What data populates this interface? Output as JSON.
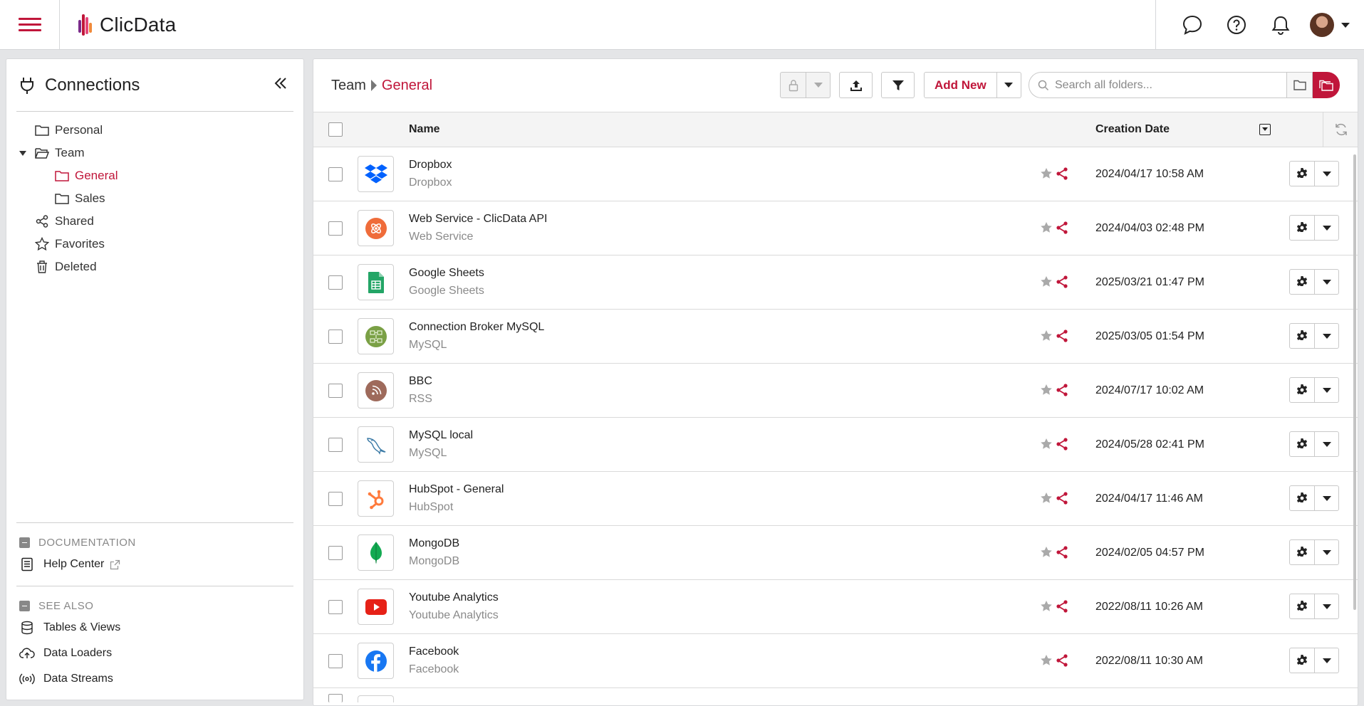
{
  "app": {
    "brand_name": "ClicData"
  },
  "colors": {
    "accent": "#c0163a"
  },
  "sidebar": {
    "title": "Connections",
    "tree": [
      {
        "label": "Personal",
        "icon": "folder-icon"
      },
      {
        "label": "Team",
        "icon": "folder-open-icon",
        "expanded": true
      },
      {
        "label": "General",
        "icon": "folder-icon",
        "selected": true
      },
      {
        "label": "Sales",
        "icon": "folder-icon"
      },
      {
        "label": "Shared",
        "icon": "share-icon"
      },
      {
        "label": "Favorites",
        "icon": "star-icon"
      },
      {
        "label": "Deleted",
        "icon": "trash-icon"
      }
    ],
    "documentation": {
      "heading": "DOCUMENTATION",
      "help_center": "Help Center"
    },
    "see_also": {
      "heading": "SEE ALSO",
      "links": [
        "Tables & Views",
        "Data Loaders",
        "Data Streams"
      ]
    }
  },
  "breadcrumb": {
    "root": "Team",
    "current": "General"
  },
  "toolbar": {
    "add_new_label": "Add New",
    "search_placeholder": "Search all folders..."
  },
  "table": {
    "headers": {
      "name": "Name",
      "creation_date": "Creation Date"
    },
    "rows": [
      {
        "name": "Dropbox",
        "type": "Dropbox",
        "date": "2024/04/17 10:58 AM",
        "logo": "dropbox-icon"
      },
      {
        "name": "Web Service - ClicData API",
        "type": "Web Service",
        "date": "2024/04/03 02:48 PM",
        "logo": "web-service-icon"
      },
      {
        "name": "Google Sheets",
        "type": "Google Sheets",
        "date": "2025/03/21 01:47 PM",
        "logo": "google-sheets-icon"
      },
      {
        "name": "Connection Broker MySQL",
        "type": "MySQL",
        "date": "2025/03/05 01:54 PM",
        "logo": "connection-broker-icon"
      },
      {
        "name": "BBC",
        "type": "RSS",
        "date": "2024/07/17 10:02 AM",
        "logo": "rss-icon"
      },
      {
        "name": "MySQL local",
        "type": "MySQL",
        "date": "2024/05/28 02:41 PM",
        "logo": "mysql-icon"
      },
      {
        "name": "HubSpot - General",
        "type": "HubSpot",
        "date": "2024/04/17 11:46 AM",
        "logo": "hubspot-icon"
      },
      {
        "name": "MongoDB",
        "type": "MongoDB",
        "date": "2024/02/05 04:57 PM",
        "logo": "mongodb-icon"
      },
      {
        "name": "Youtube Analytics",
        "type": "Youtube Analytics",
        "date": "2022/08/11 10:26 AM",
        "logo": "youtube-icon"
      },
      {
        "name": "Facebook",
        "type": "Facebook",
        "date": "2022/08/11 10:30 AM",
        "logo": "facebook-icon"
      }
    ]
  }
}
